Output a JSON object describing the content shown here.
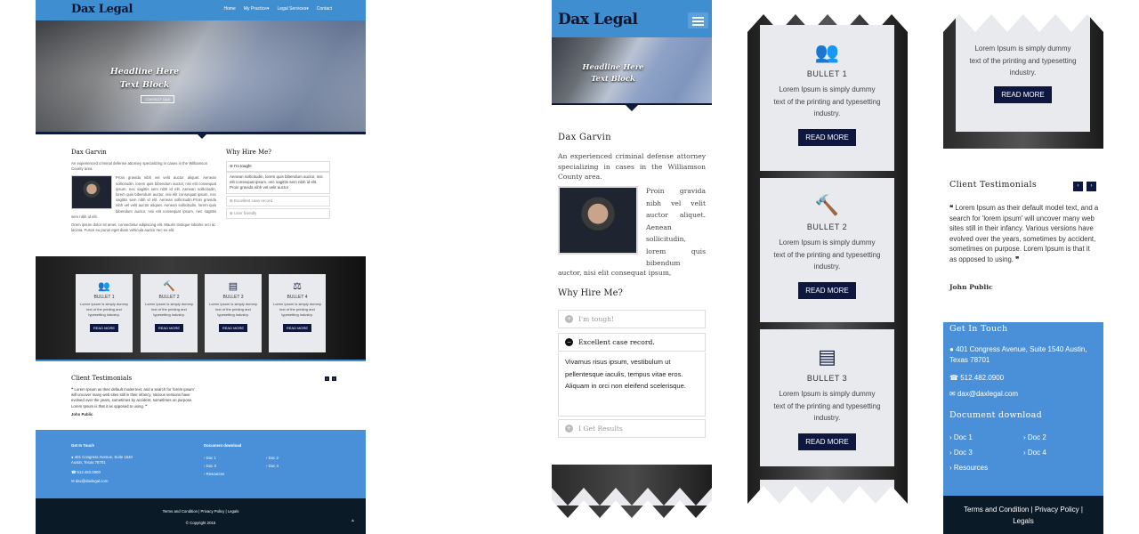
{
  "brand": {
    "logo": "Dax Legal",
    "accent": "#3e8ed0",
    "navy": "#0d1740",
    "footer_blue": "#4a90d9"
  },
  "nav": {
    "home": "Home",
    "practice": "My Practice",
    "services": "Legal Services",
    "contact": "Contact"
  },
  "hero": {
    "line1": "Headline Here",
    "line2": "Text Block",
    "button": "CONTACT DAX"
  },
  "about": {
    "name": "Dax Garvin",
    "intro": "An experienced criminal defense attorney specializing in cases in the Williamson County area.",
    "intro_desktop": "An experienced criminal defense attorney specializing in cases in the Williamson County area.",
    "bio_desktop": "Proin gravida nibh vel velit auctor aliquet. Aenean sollicitudin, lorem quis bibendum auctor, nisi elit consequat ipsum, nec sagittis sem nibh id elit. Aenean sollicitudin, lorem quis bibendum auctor, nisi elit consequat ipsum, nec sagittis sem nibh id elit. Aenean sollicitudin.Proin gravida nibh vel velit auctor aliquet. Aenean sollicitudin, lorem quis bibendum auctor, nisi elit consequat ipsum, nec sagittis sem nibh id elit.",
    "bio_desktop_2": "Orem ipsum dolor sit amet, consectetur adipiscing elit. Mauris tristique lobortis orci ac lacinia. Fusce eu purus eget diam vehicula auctor nec eu elit.",
    "bio_mobile": "Proin gravida nibh vel velit auctor aliquet. Aenean sollicitudin, lorem quis bibendum",
    "bio_mobile_cont": "auctor, nisi elit consequat ipsum,"
  },
  "why": {
    "title": "Why Hire Me?",
    "items": [
      {
        "label": "I'm tough!",
        "body": "Aenean sollicitudin, lorem quis bibendum auctor, nisi elit consequat ipsum, nec sagittis sem nibh id elit. Proin gravida nibh vel velit auctor"
      },
      {
        "label": "Excellent case record.",
        "body": "Vivamus risus ipsum, vestibulum ut pellentesque iaculis, tempus vitae eros. Aliquam in orci non eleifend scelerisque."
      },
      {
        "label": "User friendly"
      },
      {
        "label": "I Get Results"
      }
    ]
  },
  "bullets": [
    {
      "title": "BULLET 1",
      "text": "Lorem Ipsum is simply dummy text of the printing and typesetting industry.",
      "icon": "users-icon",
      "button": "READ MORE"
    },
    {
      "title": "BULLET 2",
      "text": "Lorem Ipsum is simply dummy text of the printing and typesetting industry.",
      "icon": "gavel-icon",
      "button": "READ MORE"
    },
    {
      "title": "BULLET 3",
      "text": "Lorem Ipsum is simply dummy text of the printing and typesetting industry.",
      "icon": "document-icon",
      "button": "READ MORE"
    },
    {
      "title": "BULLET 4",
      "text": "Lorem Ipsum is simply dummy text of the printing and typesetting industry.",
      "icon": "scales-icon",
      "button": "READ MORE"
    }
  ],
  "testimonials": {
    "title": "Client Testimonials",
    "quote": "Lorem Ipsum as their default model text, and a search for 'lorem ipsum' will uncover many web sites still in their infancy. Various versions have evolved over the years, sometimes by accident, sometimes on purpose. Lorem Ipsum is that it as opposed to using.",
    "author": "John Public"
  },
  "contact": {
    "title": "Get In Touch",
    "address": "401 Congress Avenue, Suite 1540 Austin, Texas 78701",
    "phone": "512.482.0900",
    "email": "dax@daxlegal.com"
  },
  "documents": {
    "title": "Document download",
    "items": [
      "Doc 1",
      "Doc 2",
      "Doc 3",
      "Doc 4",
      "Resources"
    ]
  },
  "footer": {
    "terms": "Terms and Condition",
    "privacy": "Privacy Policy",
    "legals": "Legals",
    "copyright": "© Copyright 2015"
  }
}
